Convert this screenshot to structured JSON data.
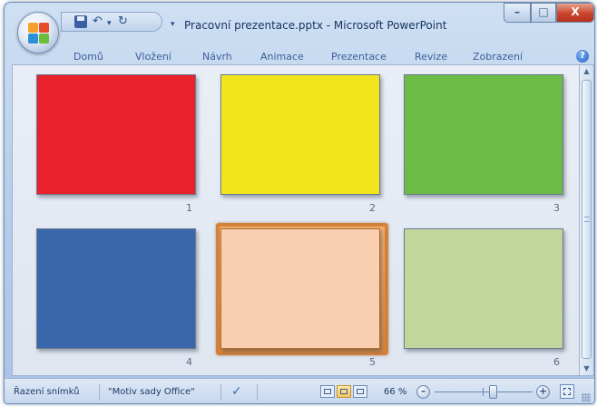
{
  "window": {
    "title": "Pracovní prezentace.pptx - Microsoft PowerPoint"
  },
  "qat": {
    "save_icon": "save-icon",
    "undo_glyph": "↶",
    "redo_glyph": "↻",
    "dropdown_glyph": "▾"
  },
  "controls": {
    "minimize": "–",
    "maximize": "□",
    "close": "X"
  },
  "ribbon": {
    "tabs": [
      "Domů",
      "Vložení",
      "Návrh",
      "Animace",
      "Prezentace",
      "Revize",
      "Zobrazení"
    ],
    "help_glyph": "?"
  },
  "slides": [
    {
      "number": "1",
      "color": "#e8212a"
    },
    {
      "number": "2",
      "color": "#f2e51c"
    },
    {
      "number": "3",
      "color": "#6dbb47"
    },
    {
      "number": "4",
      "color": "#3a66ac"
    },
    {
      "number": "5",
      "color": "#f8cfb0"
    },
    {
      "number": "6",
      "color": "#c2d69c"
    }
  ],
  "selected_slide": "5",
  "statusbar": {
    "view_name": "Řazení snímků",
    "theme": "\"Motiv sady Office\"",
    "spell_icon": "proofing-check-icon",
    "spell_glyph": "✓",
    "zoom": "66 %",
    "zoom_out": "–",
    "zoom_in": "+"
  }
}
